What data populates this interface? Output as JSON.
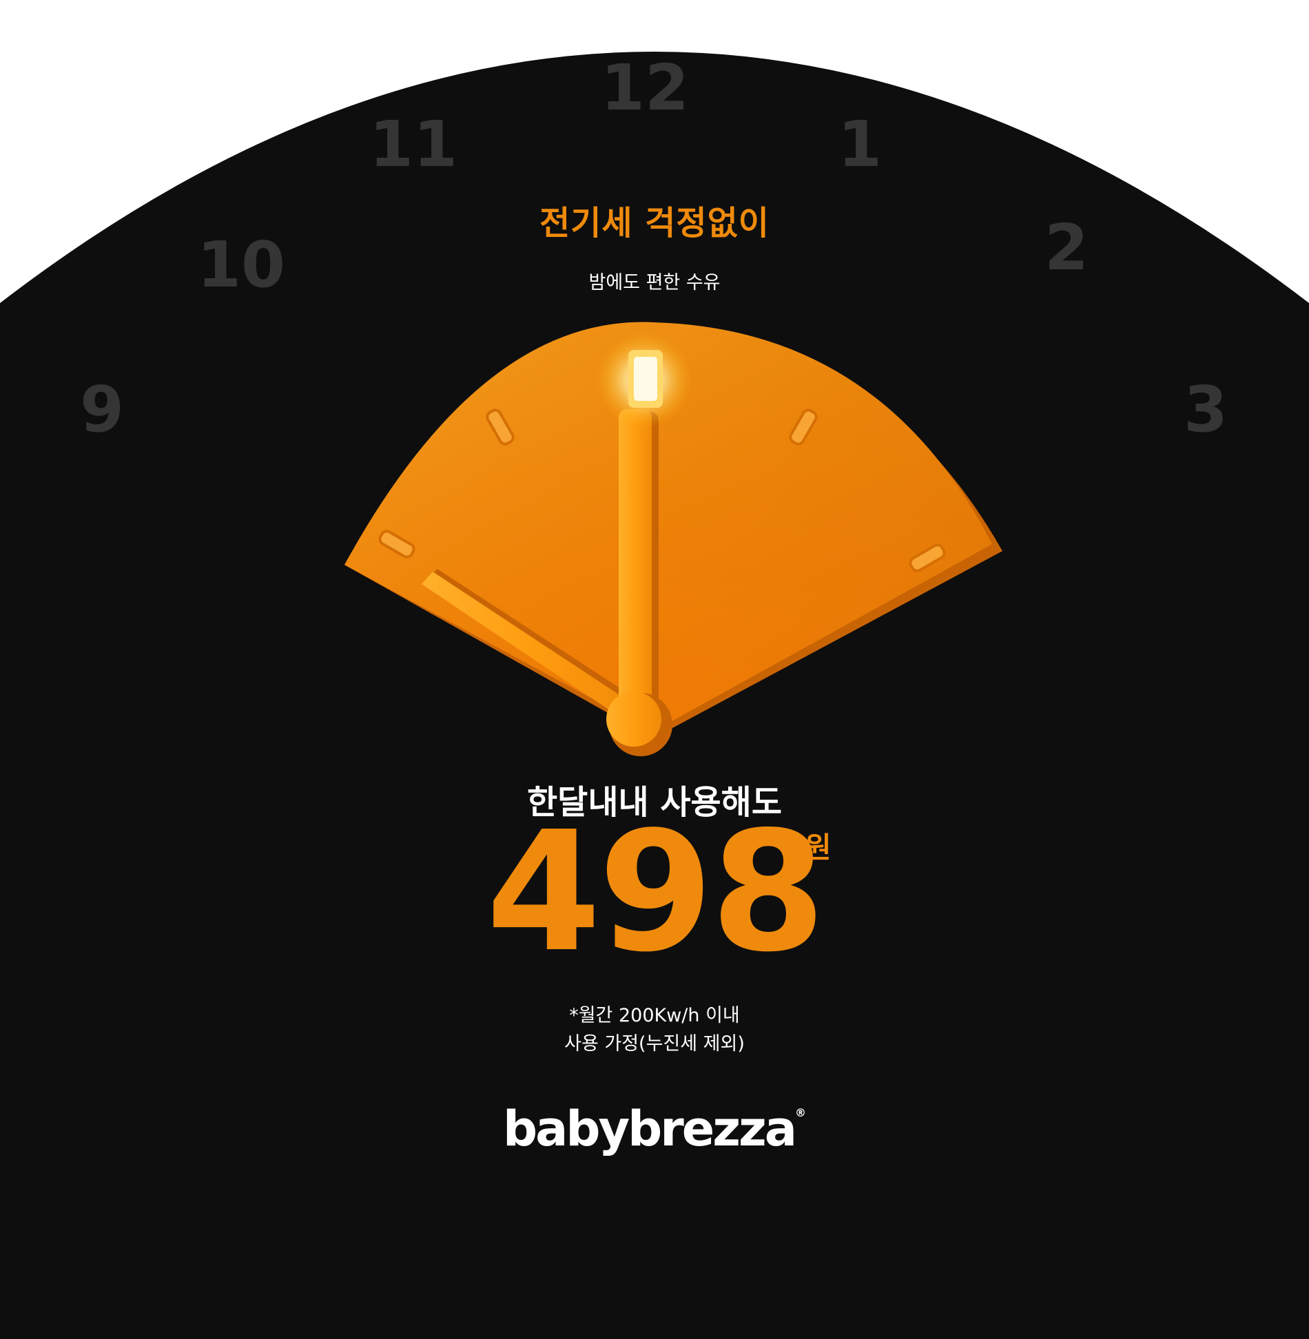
{
  "colors": {
    "background": "#0e0e0e",
    "accent": "#ef8a0c",
    "dial_numerals": "#353535",
    "text_light": "#ffffff"
  },
  "dial": {
    "numerals": [
      "9",
      "10",
      "11",
      "12",
      "1",
      "2",
      "3"
    ]
  },
  "headline": {
    "main": "전기세 걱정없이",
    "sub": "밤에도 편한 수유"
  },
  "usage": {
    "label": "한달내내 사용해도",
    "price": "498",
    "unit": "원",
    "note_line1": "*월간 200Kw/h 이내",
    "note_line2": "사용 가정(누진세 제외)"
  },
  "brand": {
    "logo_text": "babybrezza",
    "registered_mark": "®"
  },
  "illustration": {
    "subject": "orange clock sector",
    "hands": [
      "hour-hand",
      "minute-hand"
    ],
    "glow_icon": "glowing-tip-icon"
  }
}
